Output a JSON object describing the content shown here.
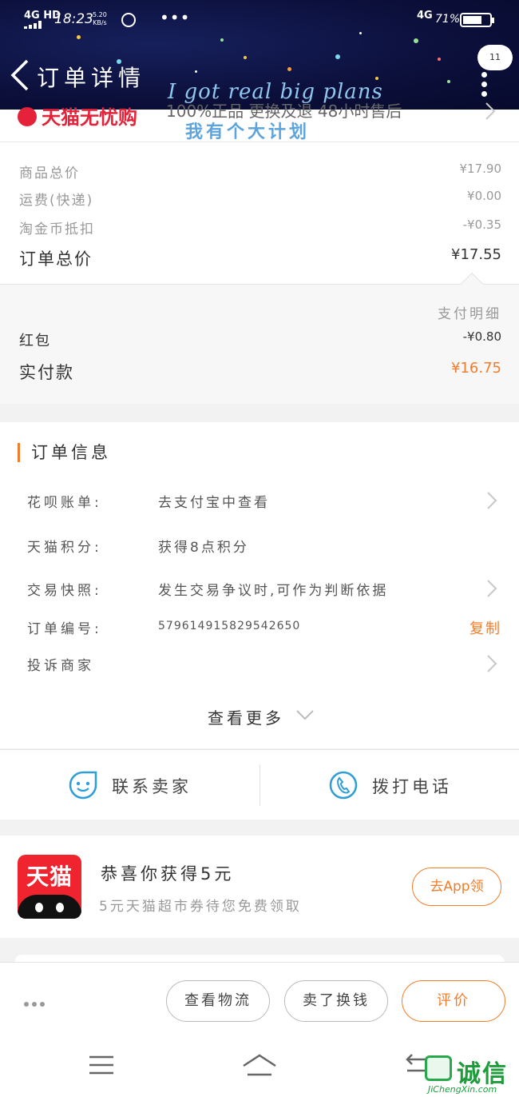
{
  "status_bar": {
    "network": "4G HD",
    "time": "18:23",
    "speed_value": "5.20",
    "speed_unit": "KB/s",
    "dots": "•••",
    "signal_type": "4G",
    "battery_pct": "71%",
    "battery_level": 0.71
  },
  "header": {
    "title": "订单详情",
    "bubble_count": "11",
    "watermark_en": "I got real big plans",
    "watermark_zh": "我有个大计划"
  },
  "shop": {
    "badge": "天猫无忧购",
    "promise": "100%正品  更换及退  48小时售后"
  },
  "price_summary": {
    "rows": [
      {
        "label": "商品总价",
        "value": "¥17.90"
      },
      {
        "label": "运费(快递)",
        "value": "¥0.00"
      },
      {
        "label": "淘金币抵扣",
        "value": "-¥0.35"
      }
    ],
    "total_label": "订单总价",
    "total_value": "¥17.55"
  },
  "payment": {
    "detail_label": "支付明细",
    "red_packet_label": "红包",
    "red_packet_value": "-¥0.80",
    "paid_label": "实付款",
    "paid_value": "¥16.75"
  },
  "order_info": {
    "title": "订单信息",
    "rows": [
      {
        "key": "花呗账单:",
        "value": "去支付宝中查看"
      },
      {
        "key": "天猫积分:",
        "value": "获得8点积分"
      },
      {
        "key": "交易快照:",
        "value": "发生交易争议时,可作为判断依据"
      },
      {
        "key": "订单编号:",
        "value": "579614915829542650",
        "action": "复制"
      },
      {
        "key": "投诉商家",
        "value": ""
      }
    ],
    "see_more": "查看更多"
  },
  "contact": {
    "seller_label": "联系卖家",
    "phone_label": "拨打电话"
  },
  "promo": {
    "app_icon_text": "天猫",
    "title": "恭喜你获得5元",
    "subtitle": "5元天猫超市券待您免费领取",
    "button": "去App领"
  },
  "action_bar": {
    "logistics": "查看物流",
    "resell": "卖了换钱",
    "review": "评价"
  },
  "watermark_logo": {
    "text": "诚信",
    "domain": "JiChengXin.com"
  },
  "colors": {
    "accent_orange": "#f27c2a",
    "tmall_red": "#e4233a",
    "link_blue": "#2d9ed8",
    "header_bg": "#0b0f3a"
  }
}
